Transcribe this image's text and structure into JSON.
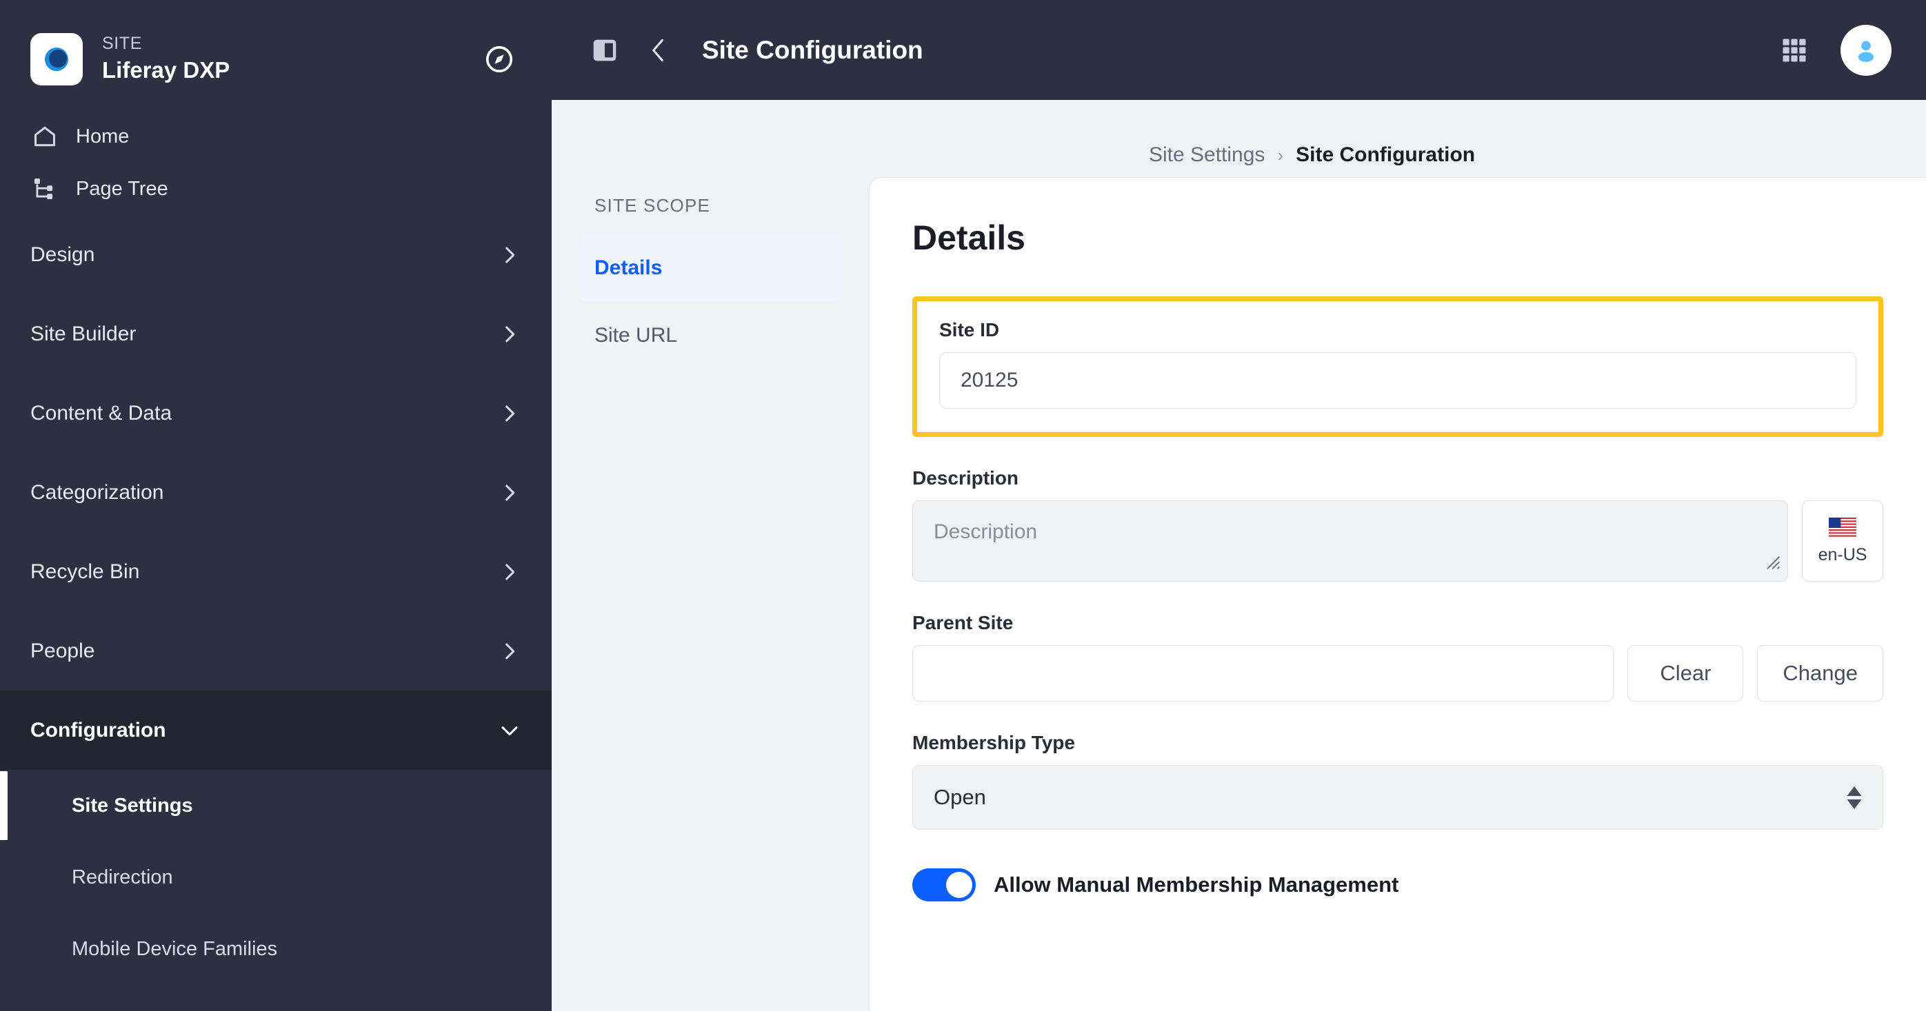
{
  "sidebar": {
    "brand": {
      "eyebrow": "SITE",
      "title": "Liferay DXP",
      "compass_icon": "compass-icon"
    },
    "nav_items": [
      {
        "label": "Home",
        "icon": "home-icon"
      },
      {
        "label": "Page Tree",
        "icon": "page-tree-icon"
      }
    ],
    "groups": [
      {
        "label": "Design",
        "state": "collapsed"
      },
      {
        "label": "Site Builder",
        "state": "collapsed"
      },
      {
        "label": "Content & Data",
        "state": "collapsed"
      },
      {
        "label": "Categorization",
        "state": "collapsed"
      },
      {
        "label": "Recycle Bin",
        "state": "collapsed"
      },
      {
        "label": "People",
        "state": "collapsed"
      },
      {
        "label": "Configuration",
        "state": "expanded"
      }
    ],
    "configuration_children": [
      {
        "label": "Site Settings",
        "active": true
      },
      {
        "label": "Redirection",
        "active": false
      },
      {
        "label": "Mobile Device Families",
        "active": false
      }
    ]
  },
  "topbar": {
    "panel_toggle_icon": "sidebar-toggle-icon",
    "back_icon": "chevron-left-icon",
    "title": "Site Configuration",
    "apps_icon": "grid-apps-icon",
    "avatar_icon": "user-avatar-icon"
  },
  "breadcrumb": {
    "parent": "Site Settings",
    "separator": "›",
    "current": "Site Configuration"
  },
  "subnav": {
    "title": "SITE SCOPE",
    "items": [
      {
        "label": "Details",
        "active": true
      },
      {
        "label": "Site URL",
        "active": false
      }
    ]
  },
  "details": {
    "title": "Details",
    "site_id": {
      "label": "Site ID",
      "value": "20125",
      "highlighted": true
    },
    "description": {
      "label": "Description",
      "value": "",
      "placeholder": "Description",
      "language_code": "en-US",
      "flag_icon": "us-flag-icon"
    },
    "parent_site": {
      "label": "Parent Site",
      "value": "",
      "clear_label": "Clear",
      "change_label": "Change"
    },
    "membership_type": {
      "label": "Membership Type",
      "value": "Open",
      "options": [
        "Open"
      ]
    },
    "allow_manual_membership": {
      "label": "Allow Manual Membership Management",
      "enabled": true
    }
  },
  "colors": {
    "sidebar_bg": "#2E3041",
    "accent_blue": "#0B5FFF",
    "highlight_yellow": "#FFC41F",
    "pane_bg": "#F1F2F5"
  }
}
